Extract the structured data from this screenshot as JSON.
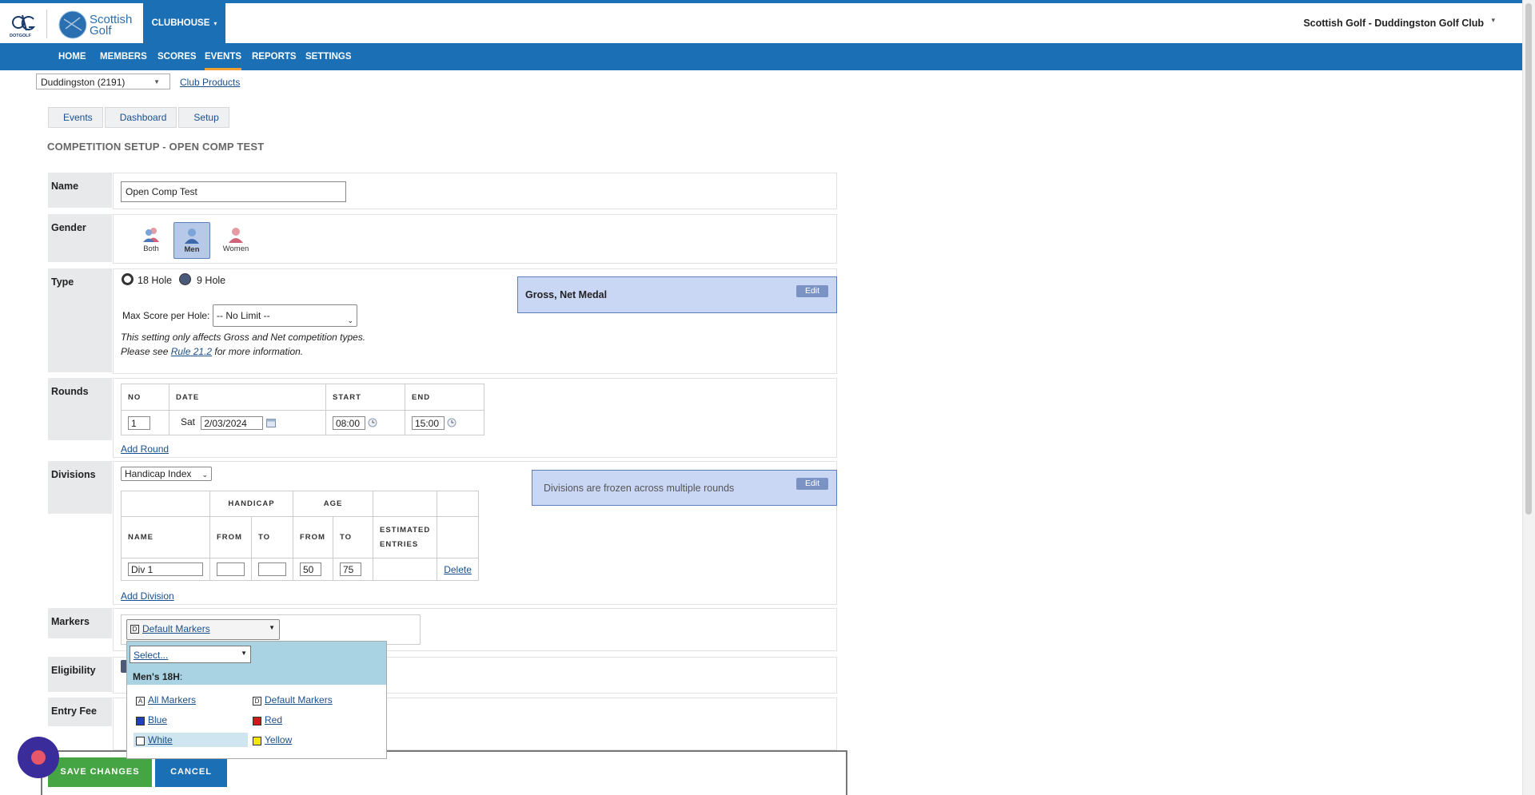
{
  "header": {
    "brand_small": "DOTGOLF",
    "brand_line1": "Scottish",
    "brand_line2": "Golf",
    "clubhouse_label": "CLUBHOUSE",
    "club_name": "Scottish Golf - Duddingston Golf Club"
  },
  "nav": {
    "items": [
      "HOME",
      "MEMBERS",
      "SCORES",
      "EVENTS",
      "REPORTS",
      "SETTINGS"
    ],
    "active": "EVENTS"
  },
  "club_select": {
    "value": "Duddingston (2191)",
    "link": "Club Products"
  },
  "breadcrumb": [
    "Events",
    "Dashboard",
    "Setup"
  ],
  "page_title": "COMPETITION SETUP - OPEN COMP TEST",
  "name_section": {
    "label": "Name",
    "value": "Open Comp Test"
  },
  "gender_section": {
    "label": "Gender",
    "options": [
      {
        "label": "Both",
        "icon": "both-gender-icon"
      },
      {
        "label": "Men",
        "icon": "male-icon"
      },
      {
        "label": "Women",
        "icon": "female-icon"
      }
    ],
    "selected": "Men"
  },
  "type_section": {
    "label": "Type",
    "option_18": "18 Hole",
    "option_9": "9 Hole",
    "selected": "18 Hole",
    "max_score_label": "Max Score per Hole:",
    "max_score_value": "-- No Limit --",
    "note_line1": "This setting only affects Gross and Net competition types.",
    "note_line2_pre": "Please see ",
    "note_link": "Rule 21.2",
    "note_line2_post": " for more information.",
    "format_box": "Gross, Net Medal",
    "edit_label": "Edit"
  },
  "rounds_section": {
    "label": "Rounds",
    "headers": [
      "NO",
      "DATE",
      "START",
      "END"
    ],
    "rows": [
      {
        "no": "1",
        "day": "Sat",
        "date": "2/03/2024",
        "start": "08:00",
        "end": "15:00"
      }
    ],
    "add_link": "Add Round"
  },
  "divisions_section": {
    "label": "Divisions",
    "type_value": "Handicap Index",
    "group_headers": [
      "HANDICAP",
      "AGE"
    ],
    "headers": [
      "NAME",
      "FROM",
      "TO",
      "FROM",
      "TO",
      "ESTIMATED",
      "ENTRIES"
    ],
    "rows": [
      {
        "name": "Div 1",
        "hcp_from": "",
        "hcp_to": "",
        "age_from": "50",
        "age_to": "75",
        "action": "Delete"
      }
    ],
    "add_link": "Add Division",
    "frozen_note": "Divisions are frozen across multiple rounds",
    "edit_label": "Edit"
  },
  "markers_section": {
    "label": "Markers",
    "selected": "Default Markers",
    "dropdown": {
      "select_placeholder": "Select...",
      "group_label": "Men's 18H",
      "group_suffix": ":",
      "items": [
        {
          "label": "All Markers",
          "glyph": "A",
          "color": "#ffffff"
        },
        {
          "label": "Default Markers",
          "glyph": "D",
          "color": "#ffffff"
        },
        {
          "label": "Blue",
          "glyph": "",
          "color": "#1f3fbf"
        },
        {
          "label": "Red",
          "glyph": "",
          "color": "#d01818"
        },
        {
          "label": "White",
          "glyph": "",
          "color": "#ffffff"
        },
        {
          "label": "Yellow",
          "glyph": "",
          "color": "#f2e800"
        }
      ],
      "highlighted": "White"
    }
  },
  "eligibility_section": {
    "label": "Eligibility"
  },
  "entry_fee_section": {
    "label": "Entry Fee"
  },
  "actions": {
    "save": "SAVE CHANGES",
    "cancel": "CANCEL"
  },
  "colors": {
    "primary": "#1a6fb5",
    "save": "#45a545",
    "info": "#c9d7f5",
    "dropdown_header": "#a9d3e3",
    "chat": "#3a2d9b"
  }
}
